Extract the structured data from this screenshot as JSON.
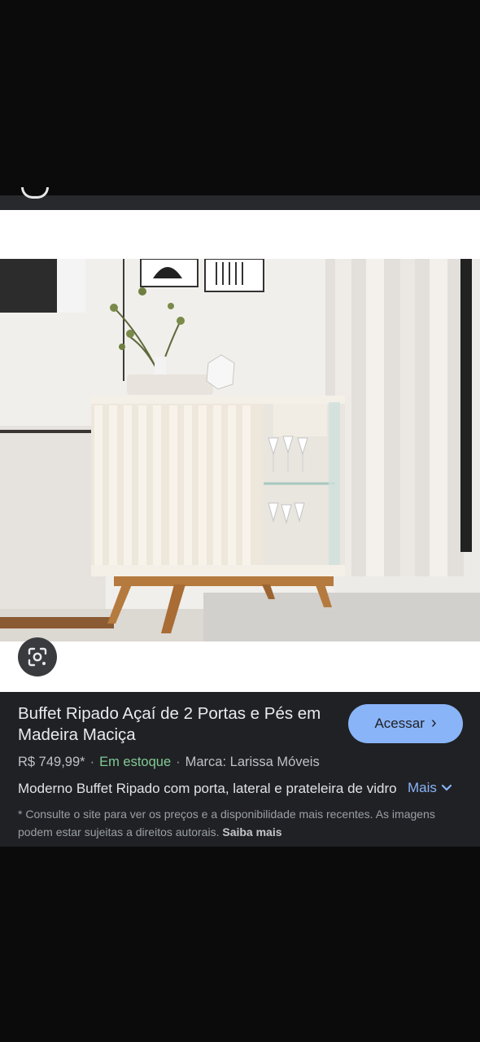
{
  "product": {
    "title": "Buffet Ripado Açaí de 2 Portas e Pés em Madeira Maciça",
    "price": "R$ 749,99*",
    "stock": "Em estoque",
    "separator": "·",
    "brand": "Marca: Larissa Móveis",
    "description": "Moderno Buffet Ripado com porta, lateral e prateleira de vidro",
    "image_subject": "Buffet ripado off-white com pés de madeira"
  },
  "actions": {
    "visit_label": "Acessar",
    "more_label": "Mais"
  },
  "disclaimer": {
    "text": "* Consulte o site para ver os preços e a disponibilidade mais recentes. As imagens podem estar sujeitas a direitos autorais.",
    "link": "Saiba mais"
  },
  "colors": {
    "panel_bg": "#202124",
    "accent": "#8ab4f8",
    "in_stock": "#81c995"
  },
  "icons": {
    "lens": "google-lens-icon",
    "visit_chevron": "chevron-right-icon",
    "more_chevron": "chevron-down-icon"
  }
}
